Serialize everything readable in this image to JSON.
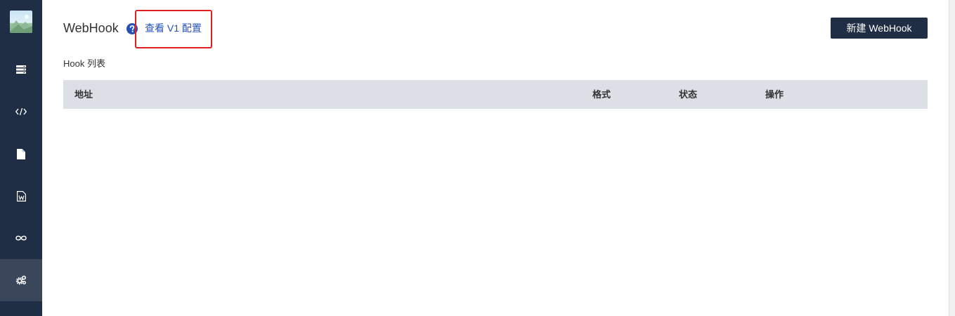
{
  "sidebar": {
    "items": [
      {
        "name": "storage",
        "icon": "server-stack-icon",
        "active": false
      },
      {
        "name": "code",
        "icon": "code-icon",
        "active": false
      },
      {
        "name": "document",
        "icon": "file-icon",
        "active": false
      },
      {
        "name": "word-document",
        "icon": "word-file-icon",
        "active": false
      },
      {
        "name": "integration",
        "icon": "infinity-icon",
        "active": false
      },
      {
        "name": "settings",
        "icon": "gears-icon",
        "active": true
      }
    ]
  },
  "header": {
    "title": "WebHook",
    "help_icon": "question-circle-icon",
    "v1_link": "查看 V1 配置",
    "new_button": "新建 WebHook"
  },
  "section": {
    "label": "Hook 列表"
  },
  "table": {
    "columns": [
      "地址",
      "格式",
      "状态",
      "操作"
    ],
    "rows": []
  },
  "colors": {
    "sidebar_bg": "#1f2d45",
    "sidebar_active": "#3a4659",
    "link": "#2351b8",
    "table_header_bg": "#dce0e6",
    "highlight": "#e02020"
  }
}
